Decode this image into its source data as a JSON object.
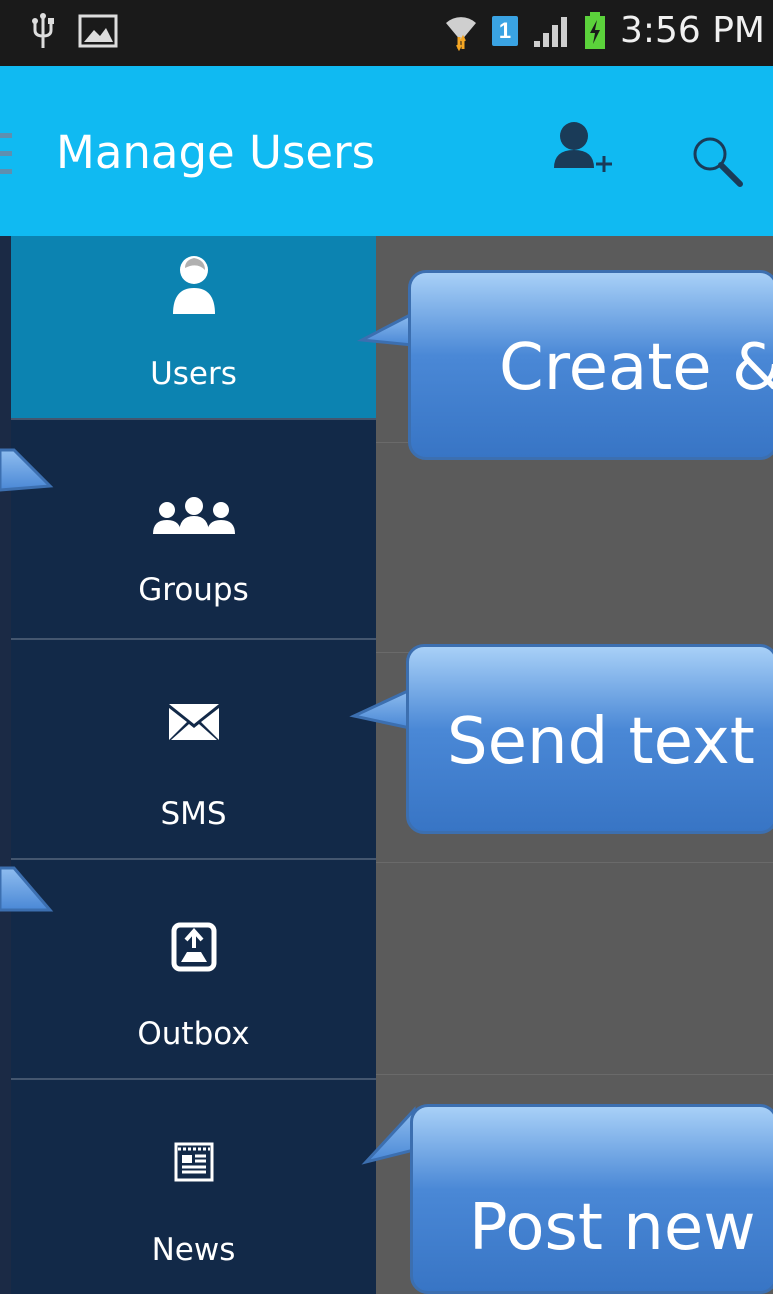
{
  "status_bar": {
    "time": "3:56 PM",
    "sim_slot": "1",
    "icons": [
      "usb-icon",
      "image-notification-icon",
      "wifi-icon",
      "signal-icon",
      "battery-charging-icon"
    ]
  },
  "action_bar": {
    "title": "Manage Users",
    "icons": [
      "menu-icon",
      "add-user-icon",
      "search-icon"
    ],
    "color": "#10baf2"
  },
  "drawer": {
    "items": [
      {
        "label": "Users",
        "icon": "user-icon",
        "active": true
      },
      {
        "label": "Groups",
        "icon": "groups-icon",
        "active": false
      },
      {
        "label": "SMS",
        "icon": "envelope-icon",
        "active": false
      },
      {
        "label": "Outbox",
        "icon": "outbox-icon",
        "active": false
      },
      {
        "label": "News",
        "icon": "news-icon",
        "active": false
      }
    ],
    "active_color": "#0c83b1",
    "background": "#122948"
  },
  "callouts": [
    {
      "text": "Create &"
    },
    {
      "text": "Send text"
    },
    {
      "text": "Post new"
    }
  ]
}
